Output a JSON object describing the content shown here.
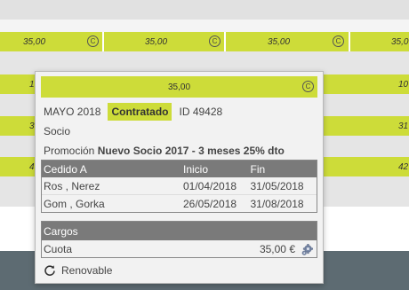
{
  "background": {
    "top_cells": [
      {
        "label": "35,00"
      },
      {
        "label": "35,00"
      },
      {
        "label": "35,00"
      },
      {
        "label": "35,0"
      }
    ],
    "left_fragments": [
      "1",
      "3",
      "4"
    ],
    "right_fragments": [
      "10",
      "31",
      "42"
    ]
  },
  "popover": {
    "header_amount": "35,00",
    "month_label": "MAYO 2018",
    "status_badge": "Contratado",
    "id_label": "ID 49428",
    "role": "Socio",
    "promo_prefix": "Promoción",
    "promo_name": "Nuevo Socio 2017 - 3 meses 25% dto",
    "table": {
      "headers": [
        "Cedido A",
        "Inicio",
        "Fin"
      ],
      "rows": [
        [
          "Ros , Nerez",
          "01/04/2018",
          "31/05/2018"
        ],
        [
          "Gom , Gorka",
          "26/05/2018",
          "31/08/2018"
        ]
      ]
    },
    "cargos": {
      "title": "Cargos",
      "item_label": "Cuota",
      "item_amount": "35,00 €"
    },
    "renewable_label": "Renovable"
  },
  "colors": {
    "accent": "#cddc39",
    "header_gray": "#7a7a7a",
    "dark_footer": "#5d6b72"
  },
  "icons": [
    "copyright-icon",
    "gear-icon",
    "refresh-icon"
  ]
}
